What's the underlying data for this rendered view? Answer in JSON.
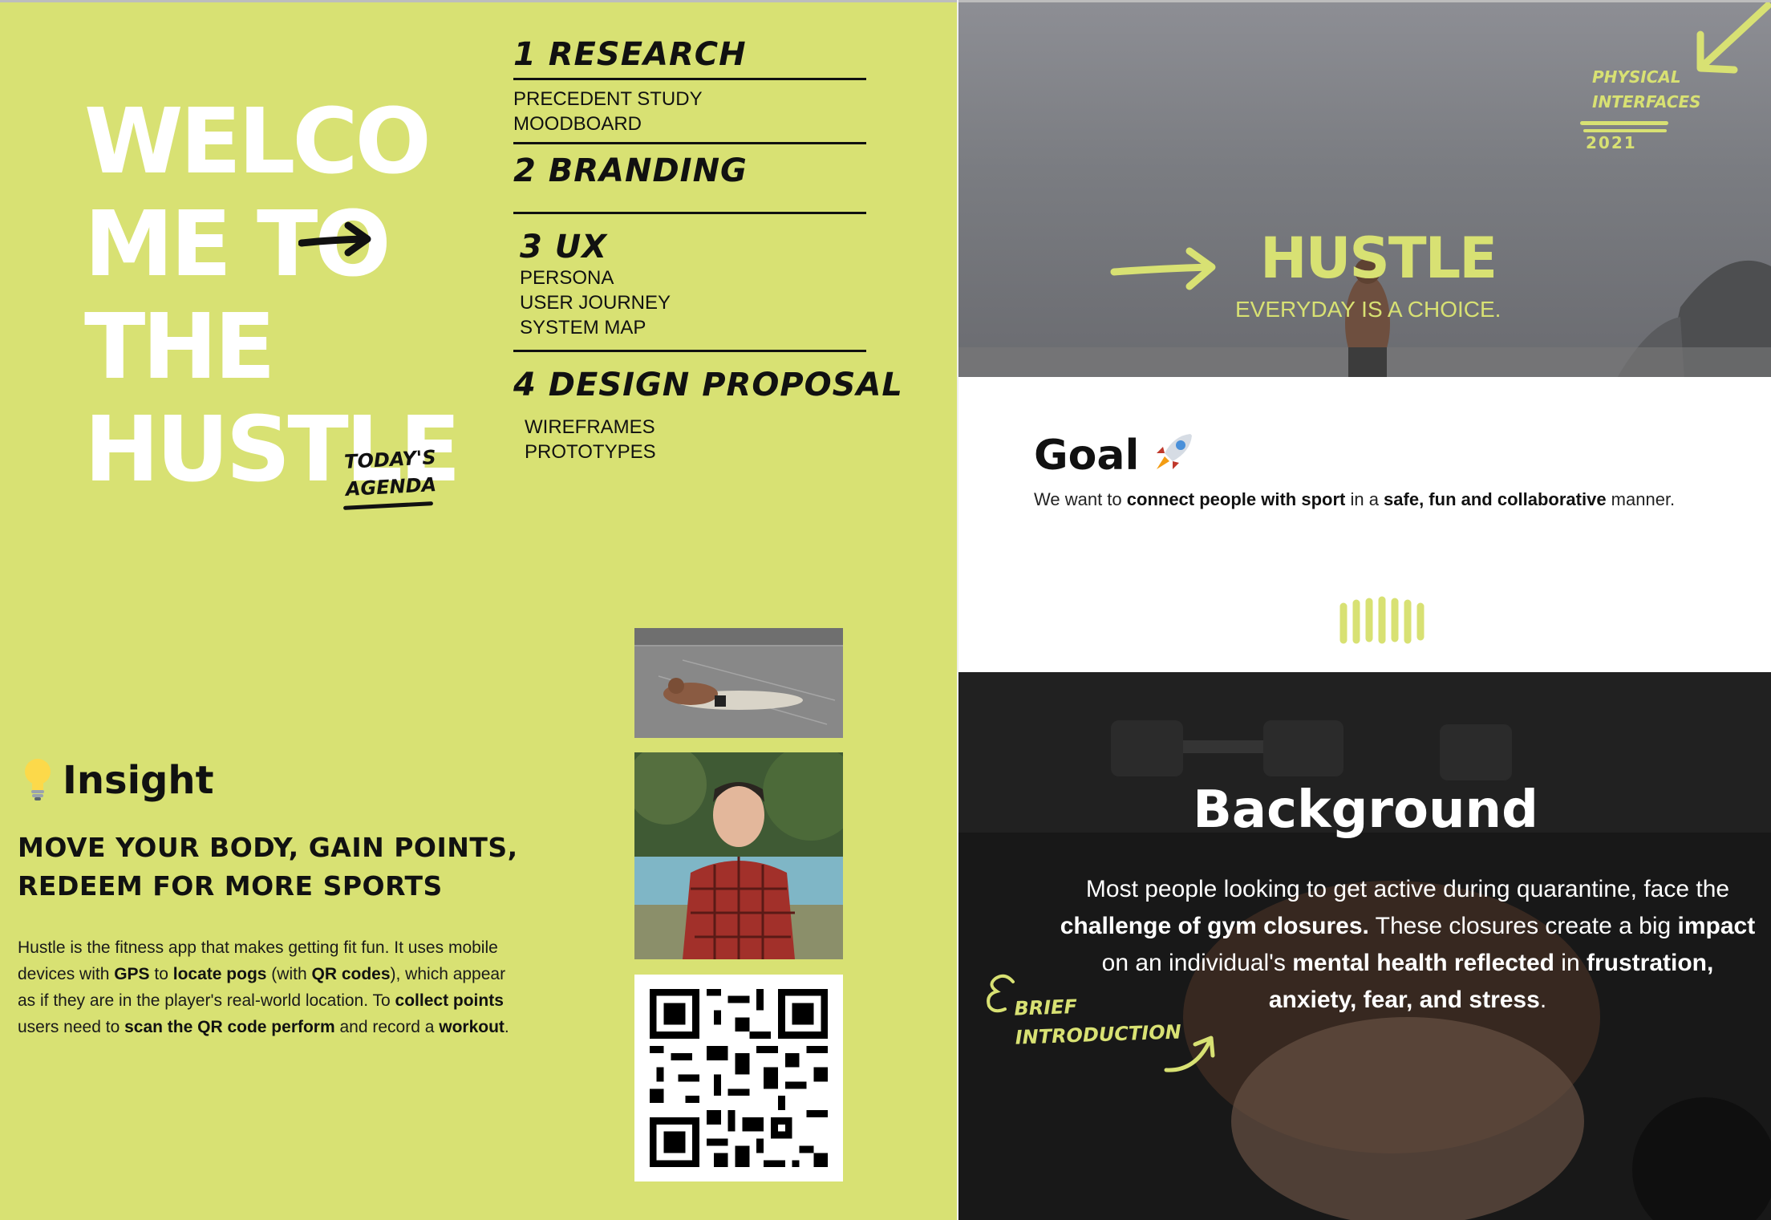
{
  "colors": {
    "accent": "#d8e173",
    "ink": "#111111",
    "white": "#ffffff"
  },
  "left": {
    "welcome": [
      "WELCO",
      "ME TO",
      "THE",
      "HUSTLE"
    ],
    "agenda_tag": [
      "TODAY'S",
      "AGENDA"
    ],
    "agenda": [
      {
        "title": "1 RESEARCH",
        "items": [
          "PRECEDENT STUDY",
          "MOODBOARD"
        ]
      },
      {
        "title": "2 BRANDING",
        "items": []
      },
      {
        "title": "3 UX",
        "items": [
          "PERSONA",
          "USER JOURNEY",
          "SYSTEM MAP"
        ]
      },
      {
        "title": "4 DESIGN PROPOSAL",
        "items": [
          "WIREFRAMES",
          "PROTOTYPES"
        ]
      }
    ],
    "insight": {
      "title": "Insight",
      "icon": "lightbulb-icon",
      "tagline": [
        "MOVE YOUR BODY, GAIN POINTS,",
        "REDEEM FOR MORE SPORTS"
      ],
      "desc": {
        "p1": "Hustle is the fitness app that makes getting fit fun. It uses mobile devices with ",
        "b1": "GPS",
        "p2": " to ",
        "b2": "locate pogs",
        "p3": " (with ",
        "b3": "QR codes",
        "p4": "), which appear as if they are in the player's real-world location. To ",
        "b4": "collect points",
        "p5": " users need to ",
        "b5": "scan the QR code perform",
        "p6": " and record a ",
        "b6": "workout",
        "p7": "."
      }
    }
  },
  "right": {
    "hero": {
      "title": "HUSTLE",
      "subtitle": "EVERYDAY IS A CHOICE.",
      "badge": [
        "PHYSICAL",
        "INTERFACES"
      ],
      "badge_year": "2021"
    },
    "goal": {
      "title": "Goal",
      "icon": "rocket-icon",
      "t1": "We want to ",
      "b1": "connect people with sport",
      "t2": " in a ",
      "b2": "safe, fun and collaborative",
      "t3": " manner."
    },
    "background": {
      "title": "Background",
      "t1": "Most people looking to get active during quarantine, face the ",
      "b1": "challenge of gym closures.",
      "t2": "  These closures create a big ",
      "b2": "impact",
      "t3": " on an individual's ",
      "b3": "mental health reflected",
      "t4": " in ",
      "b4": "frustration, anxiety, fear, and stress",
      "t5": ".",
      "brief": [
        "BRIEF",
        "INTRODUCTION"
      ]
    }
  }
}
